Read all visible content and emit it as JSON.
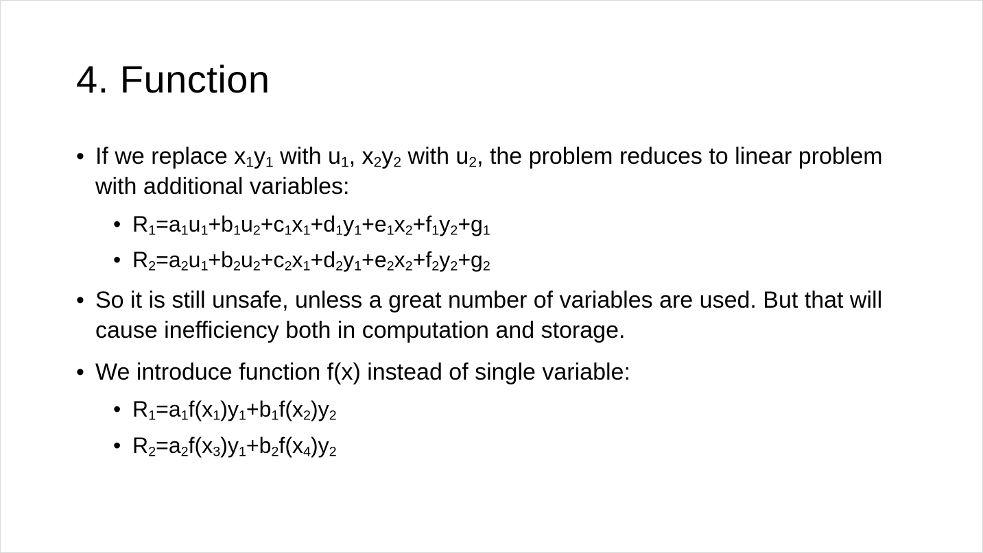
{
  "slide": {
    "title": "4. Function",
    "bullet_glyph": "•",
    "bullets": [
      {
        "segments": [
          {
            "t": "If we replace x"
          },
          {
            "s": "1"
          },
          {
            "t": "y"
          },
          {
            "s": "1"
          },
          {
            "t": " with u"
          },
          {
            "s": "1"
          },
          {
            "t": ", x"
          },
          {
            "s": "2"
          },
          {
            "t": "y"
          },
          {
            "s": "2"
          },
          {
            "t": " with u"
          },
          {
            "s": "2"
          },
          {
            "t": ", the problem reduces to linear problem with additional variables:"
          }
        ],
        "sub_bullets": [
          {
            "segments": [
              {
                "t": "R"
              },
              {
                "s": "1"
              },
              {
                "t": "=a"
              },
              {
                "s": "1"
              },
              {
                "t": "u"
              },
              {
                "s": "1"
              },
              {
                "t": "+b"
              },
              {
                "s": "1"
              },
              {
                "t": "u"
              },
              {
                "s": "2"
              },
              {
                "t": "+c"
              },
              {
                "s": "1"
              },
              {
                "t": "x"
              },
              {
                "s": "1"
              },
              {
                "t": "+d"
              },
              {
                "s": "1"
              },
              {
                "t": "y"
              },
              {
                "s": "1"
              },
              {
                "t": "+e"
              },
              {
                "s": "1"
              },
              {
                "t": "x"
              },
              {
                "s": "2"
              },
              {
                "t": "+f"
              },
              {
                "s": "1"
              },
              {
                "t": "y"
              },
              {
                "s": "2"
              },
              {
                "t": "+g"
              },
              {
                "s": "1"
              }
            ]
          },
          {
            "segments": [
              {
                "t": "R"
              },
              {
                "s": "2"
              },
              {
                "t": "=a"
              },
              {
                "s": "2"
              },
              {
                "t": "u"
              },
              {
                "s": "1"
              },
              {
                "t": "+b"
              },
              {
                "s": "2"
              },
              {
                "t": "u"
              },
              {
                "s": "2"
              },
              {
                "t": "+c"
              },
              {
                "s": "2"
              },
              {
                "t": "x"
              },
              {
                "s": "1"
              },
              {
                "t": "+d"
              },
              {
                "s": "2"
              },
              {
                "t": "y"
              },
              {
                "s": "1"
              },
              {
                "t": "+e"
              },
              {
                "s": "2"
              },
              {
                "t": "x"
              },
              {
                "s": "2"
              },
              {
                "t": "+f"
              },
              {
                "s": "2"
              },
              {
                "t": "y"
              },
              {
                "s": "2"
              },
              {
                "t": "+g"
              },
              {
                "s": "2"
              }
            ]
          }
        ]
      },
      {
        "segments": [
          {
            "t": "So it is still unsafe, unless a great number of variables are used. But that will cause inefficiency both in computation and storage."
          }
        ],
        "sub_bullets": []
      },
      {
        "segments": [
          {
            "t": "We introduce function f(x) instead of single variable:"
          }
        ],
        "sub_bullets": [
          {
            "segments": [
              {
                "t": "R"
              },
              {
                "s": "1"
              },
              {
                "t": "=a"
              },
              {
                "s": "1"
              },
              {
                "t": "f(x"
              },
              {
                "s": "1"
              },
              {
                "t": ")y"
              },
              {
                "s": "1"
              },
              {
                "t": "+b"
              },
              {
                "s": "1"
              },
              {
                "t": "f(x"
              },
              {
                "s": "2"
              },
              {
                "t": ")y"
              },
              {
                "s": "2"
              }
            ]
          },
          {
            "segments": [
              {
                "t": "R"
              },
              {
                "s": "2"
              },
              {
                "t": "=a"
              },
              {
                "s": "2"
              },
              {
                "t": "f(x"
              },
              {
                "s": "3"
              },
              {
                "t": ")y"
              },
              {
                "s": "1"
              },
              {
                "t": "+b"
              },
              {
                "s": "2"
              },
              {
                "t": "f(x"
              },
              {
                "s": "4"
              },
              {
                "t": ")y"
              },
              {
                "s": "2"
              }
            ]
          }
        ]
      }
    ]
  }
}
